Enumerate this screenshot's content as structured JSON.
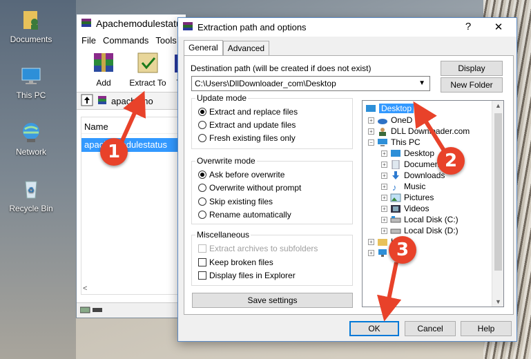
{
  "desktop": {
    "icons": [
      {
        "label": "Documents",
        "icon": "documents-user-icon"
      },
      {
        "label": "This PC",
        "icon": "this-pc-icon"
      },
      {
        "label": "Network",
        "icon": "network-globe-icon"
      },
      {
        "label": "Recycle Bin",
        "icon": "recycle-bin-icon"
      }
    ]
  },
  "rar_window": {
    "title": "Apachemodulestatus",
    "menu": [
      "File",
      "Commands",
      "Tools"
    ],
    "toolbar": {
      "add": "Add",
      "extract_to": "Extract To",
      "third": "T"
    },
    "address": "apachemo",
    "list_header": "Name",
    "selected_file": "apachemodulestatus"
  },
  "dialog": {
    "title": "Extraction path and options",
    "help_btn": "?",
    "close_btn": "✕",
    "tabs": [
      "General",
      "Advanced"
    ],
    "dest_label": "Destination path (will be created if does not exist)",
    "dest_value": "C:\\Users\\DllDownloader_com\\Desktop",
    "display_btn": "Display",
    "new_folder_btn": "New Folder",
    "update_mode": {
      "title": "Update mode",
      "options": [
        "Extract and replace files",
        "Extract and update files",
        "Fresh existing files only"
      ],
      "selected": 0
    },
    "overwrite_mode": {
      "title": "Overwrite mode",
      "options": [
        "Ask before overwrite",
        "Overwrite without prompt",
        "Skip existing files",
        "Rename automatically"
      ],
      "selected": 0
    },
    "misc": {
      "title": "Miscellaneous",
      "options": [
        "Extract archives to subfolders",
        "Keep broken files",
        "Display files in Explorer"
      ]
    },
    "save_settings": "Save settings",
    "tree": [
      {
        "label": "Desktop",
        "level": 0,
        "selected": true
      },
      {
        "label": "OneD",
        "level": 1
      },
      {
        "label": "DLL Downloader.com",
        "level": 1
      },
      {
        "label": "This PC",
        "level": 1
      },
      {
        "label": "Desktop",
        "level": 2
      },
      {
        "label": "Documents",
        "level": 2
      },
      {
        "label": "Downloads",
        "level": 2
      },
      {
        "label": "Music",
        "level": 2
      },
      {
        "label": "Pictures",
        "level": 2
      },
      {
        "label": "Videos",
        "level": 2
      },
      {
        "label": "Local Disk (C:)",
        "level": 2
      },
      {
        "label": "Local Disk (D:)",
        "level": 2
      },
      {
        "label": "L",
        "level": 1
      },
      {
        "label": "N",
        "level": 1
      }
    ],
    "ok": "OK",
    "cancel": "Cancel",
    "help": "Help"
  },
  "annotations": {
    "step1": "1",
    "step2": "2",
    "step3": "3",
    "color": "#e8422a"
  }
}
